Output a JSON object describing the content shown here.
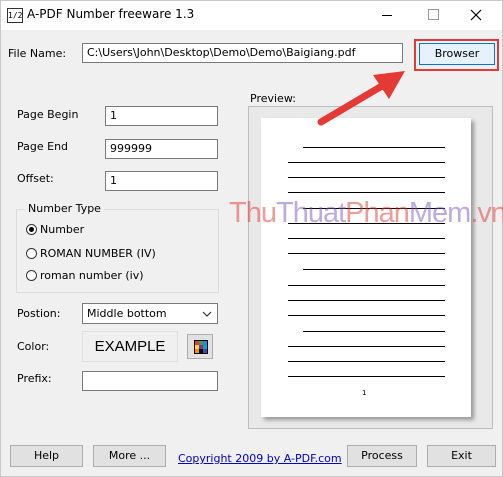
{
  "window": {
    "title": "A-PDF Number freeware 1.3",
    "icon_text": "1/2"
  },
  "file": {
    "label": "File Name:",
    "value": "C:\\Users\\John\\Desktop\\Demo\\Demo\\Baigiang.pdf",
    "browse_label": "Browser"
  },
  "page_begin": {
    "label": "Page Begin",
    "value": "1"
  },
  "page_end": {
    "label": "Page End",
    "value": "999999"
  },
  "offset": {
    "label": "Offset:",
    "value": "1"
  },
  "number_type": {
    "legend": "Number Type",
    "options": [
      {
        "label": "Number",
        "selected": true
      },
      {
        "label": "ROMAN NUMBER (IV)",
        "selected": false
      },
      {
        "label": "roman number (iv)",
        "selected": false
      }
    ]
  },
  "position": {
    "label": "Postion:",
    "value": "Middle bottom"
  },
  "color": {
    "label": "Color:",
    "example": "EXAMPLE",
    "icon": "color-palette-icon"
  },
  "prefix": {
    "label": "Prefix:",
    "value": ""
  },
  "preview": {
    "label": "Preview:",
    "page_number": "1"
  },
  "watermark": {
    "parts": [
      {
        "text": "Thu",
        "color": "#e53935"
      },
      {
        "text": "Thuat",
        "color": "#7e57c2"
      },
      {
        "text": "Phan",
        "color": "#e53935"
      },
      {
        "text": "Mem",
        "color": "#7e57c2"
      },
      {
        "text": ".vn",
        "color": "#e53935"
      }
    ]
  },
  "footer": {
    "help": "Help",
    "more": "More ...",
    "copyright": "Copyright 2009 by A-PDF.com",
    "process": "Process",
    "exit": "Exit"
  },
  "colors": {
    "annotation": "#e53935",
    "accent": "#0078d7",
    "link": "#0000cc"
  }
}
